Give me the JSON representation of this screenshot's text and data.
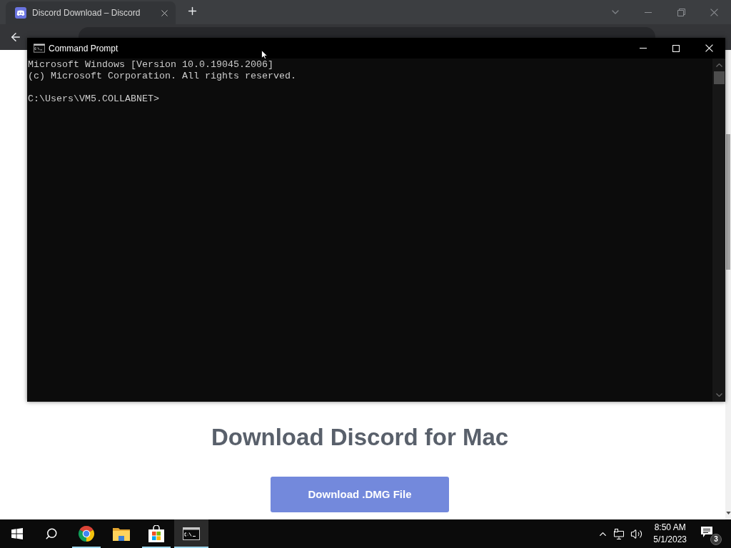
{
  "browser": {
    "tab": {
      "title": "Discord Download – Discord"
    }
  },
  "page": {
    "heading": "Download Discord for Mac",
    "download_button": "Download .DMG File"
  },
  "command_prompt": {
    "title": "Command Prompt",
    "output": [
      "Microsoft Windows [Version 10.0.19045.2006]",
      "(c) Microsoft Corporation. All rights reserved."
    ],
    "prompt": "C:\\Users\\VM5.COLLABNET>"
  },
  "taskbar": {
    "apps": [
      {
        "kind": "chrome",
        "running": true,
        "active": false
      },
      {
        "kind": "explorer",
        "running": false,
        "active": false
      },
      {
        "kind": "store",
        "running": true,
        "active": false
      },
      {
        "kind": "terminal",
        "running": true,
        "active": true
      }
    ],
    "clock": {
      "time": "8:50 AM",
      "date": "5/1/2023"
    },
    "notification_count": "3"
  }
}
